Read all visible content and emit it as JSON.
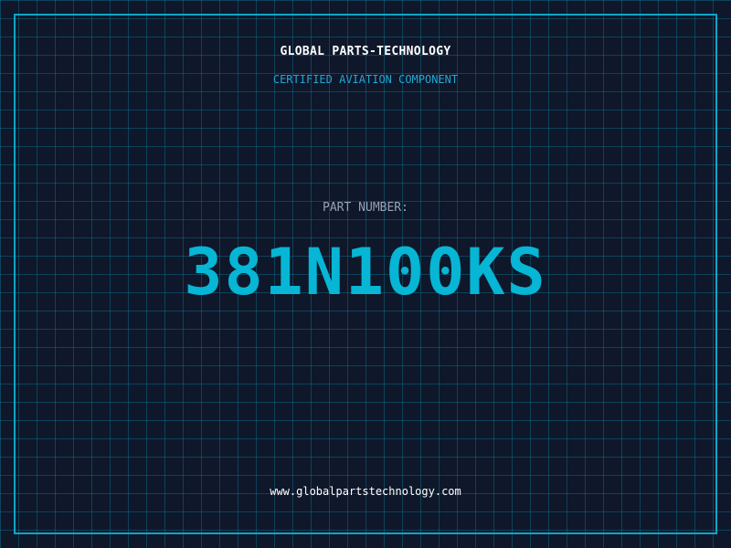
{
  "header": {
    "company": "GLOBAL PARTS-TECHNOLOGY",
    "subtitle": "CERTIFIED AVIATION COMPONENT"
  },
  "main": {
    "label": "PART NUMBER:",
    "part_number": "381N100KS"
  },
  "footer": {
    "website": "www.globalpartstechnology.com"
  },
  "colors": {
    "background": "#0f172a",
    "grid": "#0891b2",
    "accent": "#06b6d4",
    "text": "#ffffff",
    "muted": "#94a3b8"
  }
}
